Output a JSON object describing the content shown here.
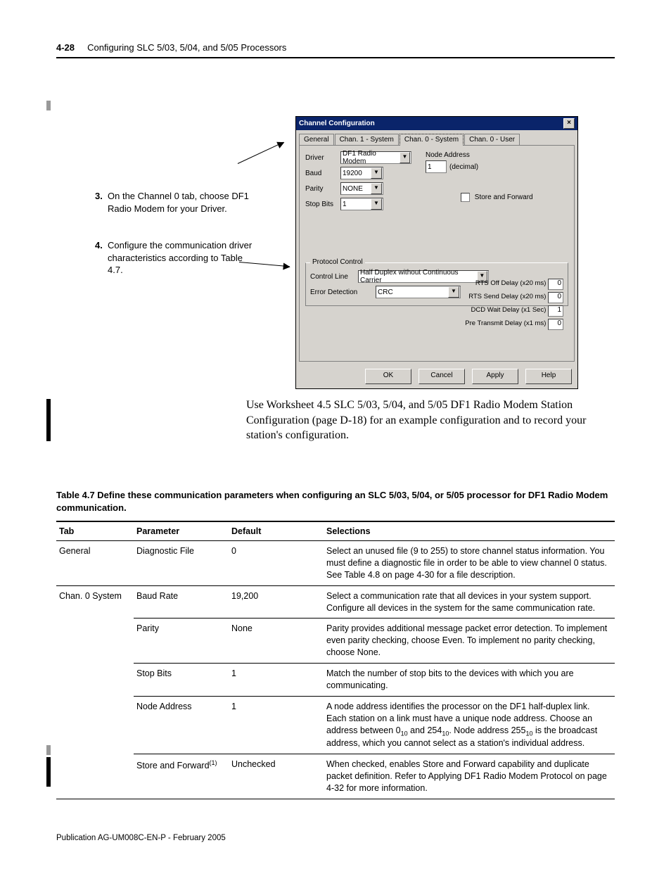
{
  "header": {
    "page_number": "4-28",
    "chapter_title": "Configuring SLC 5/03, 5/04, and 5/05 Processors"
  },
  "instructions": {
    "step3_num": "3.",
    "step3_text": "On the Channel 0 tab, choose DF1 Radio Modem for your Driver.",
    "step4_num": "4.",
    "step4_text": "Configure the communication driver characteristics according to Table 4.7."
  },
  "dialog": {
    "title": "Channel Configuration",
    "tabs": {
      "t0": "General",
      "t1": "Chan. 1 - System",
      "t2": "Chan. 0 - System",
      "t3": "Chan. 0 - User"
    },
    "driver_label": "Driver",
    "driver_value": "DF1 Radio Modem",
    "baud_label": "Baud",
    "baud_value": "19200",
    "parity_label": "Parity",
    "parity_value": "NONE",
    "stopbits_label": "Stop Bits",
    "stopbits_value": "1",
    "node_address_label": "Node Address",
    "node_address_value": "1",
    "node_address_unit": "(decimal)",
    "store_forward_label": "Store and Forward",
    "group_title": "Protocol Control",
    "control_line_label": "Control Line",
    "control_line_value": "Half Duplex without Continuous Carrier",
    "error_detection_label": "Error Detection",
    "error_detection_value": "CRC",
    "rts_off_label": "RTS Off Delay (x20 ms)",
    "rts_off_value": "0",
    "rts_send_label": "RTS Send Delay (x20 ms)",
    "rts_send_value": "0",
    "dcd_wait_label": "DCD Wait Delay (x1 Sec)",
    "dcd_wait_value": "1",
    "pre_transmit_label": "Pre Transmit Delay (x1 ms)",
    "pre_transmit_value": "0",
    "btn_ok": "OK",
    "btn_cancel": "Cancel",
    "btn_apply": "Apply",
    "btn_help": "Help",
    "close_x": "×"
  },
  "body_paragraph": "Use Worksheet 4.5 SLC 5/03, 5/04, and 5/05 DF1 Radio Modem Station Configuration (page D-18) for an example configuration and to record your station's configuration.",
  "table": {
    "caption": "Table 4.7 Define these communication parameters when configuring an SLC 5/03, 5/04, or 5/05 processor for DF1 Radio Modem communication.",
    "h_tab": "Tab",
    "h_param": "Parameter",
    "h_default": "Default",
    "h_sel": "Selections",
    "r1_tab": "General",
    "r1_param": "Diagnostic File",
    "r1_default": "0",
    "r1_sel": "Select an unused file (9 to 255) to store channel status information. You must define a diagnostic file in order to be able to view channel 0 status. See Table 4.8 on page 4-30 for a file description.",
    "r2_tab": "Chan. 0 System",
    "r2_param": "Baud Rate",
    "r2_default": "19,200",
    "r2_sel": "Select a communication rate that all devices in your system support. Configure all devices in the system for the same communication rate.",
    "r3_param": "Parity",
    "r3_default": "None",
    "r3_sel": "Parity provides additional message packet error detection. To implement even parity checking, choose Even. To implement no parity checking, choose None.",
    "r4_param": "Stop Bits",
    "r4_default": "1",
    "r4_sel": "Match the number of stop bits to the devices with which you are communicating.",
    "r5_param": "Node Address",
    "r5_default": "1",
    "r6_param_a": "Store and Forward",
    "r6_param_b": "(1)",
    "r6_default": "Unchecked",
    "r6_sel": "When checked, enables Store and Forward capability and duplicate packet definition. Refer to Applying DF1 Radio Modem Protocol on page 4-32 for more information.",
    "r5_sel_a": "A node address identifies the processor on the DF1 half-duplex link. Each station on a link must have a unique node address. Choose an address between 0",
    "r5_sel_b": " and 254",
    "r5_sel_c": ". Node address 255",
    "r5_sel_d": " is the broadcast address, which you cannot select as a station's individual address.",
    "sub10": "10"
  },
  "footer": "Publication AG-UM008C-EN-P - February 2005"
}
